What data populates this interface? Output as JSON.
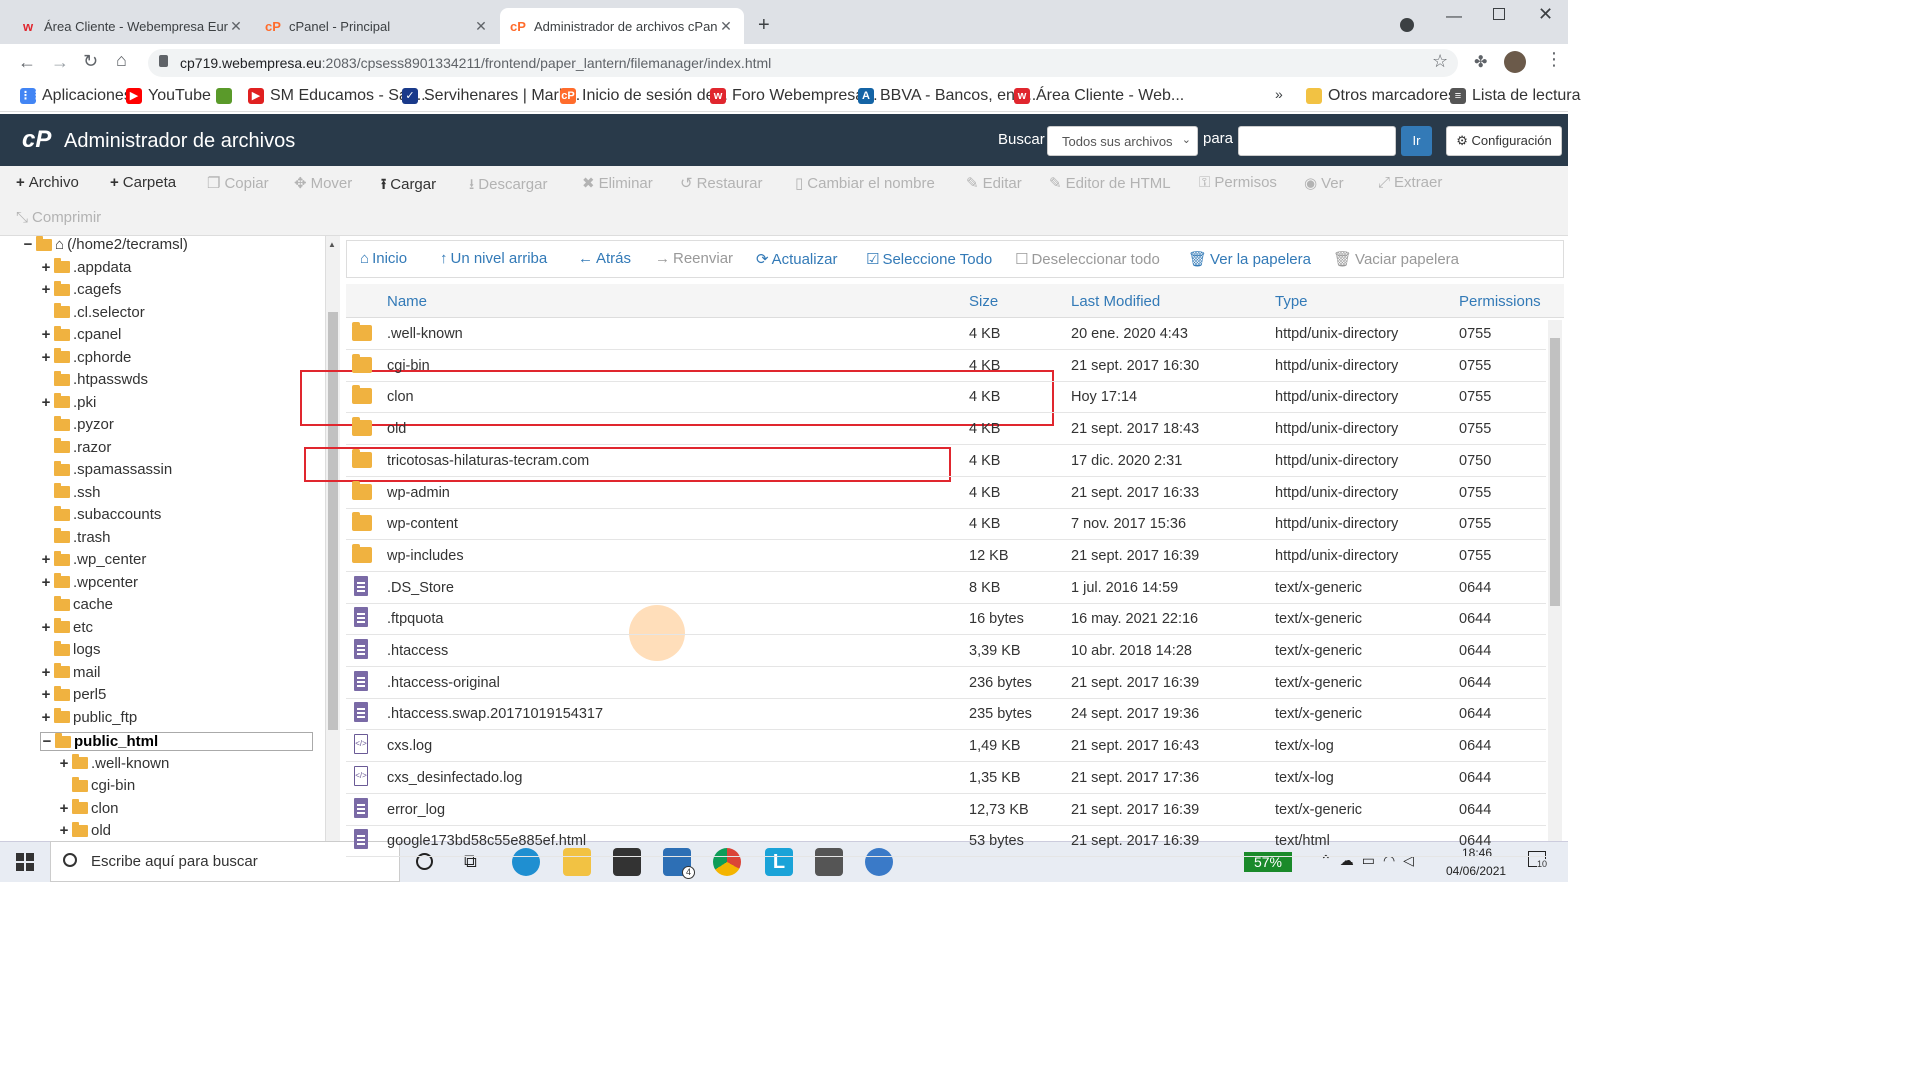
{
  "browser": {
    "tabs": [
      {
        "label": "Área Cliente - Webempresa Euro",
        "active": false
      },
      {
        "label": "cPanel - Principal",
        "active": false
      },
      {
        "label": "Administrador de archivos cPane",
        "active": true
      }
    ],
    "url_host": "cp719.webempresa.eu",
    "url_rest": ":2083/cpsess8901334211/frontend/paper_lantern/filemanager/index.html",
    "bookmarks": [
      "Aplicaciones",
      "YouTube",
      "SM Educamos - San...",
      "Servihenares | Mark...",
      "Inicio de sesión de...",
      "Foro Webempresa...",
      "BBVA - Bancos, enti...",
      "Área Cliente - Web...",
      "Otros marcadores",
      "Lista de lectura"
    ],
    "more_bookmarks": "»"
  },
  "header": {
    "title": "Administrador de archivos",
    "search_label": "Buscar",
    "search_scope": "Todos sus archivos",
    "for_label": "para",
    "go_label": "Ir",
    "settings_label": "Configuración"
  },
  "toolbar": [
    {
      "label": "Archivo",
      "enabled": true,
      "icon": "+"
    },
    {
      "label": "Carpeta",
      "enabled": true,
      "icon": "+"
    },
    {
      "label": "Copiar",
      "enabled": false,
      "icon": "❐"
    },
    {
      "label": "Mover",
      "enabled": false,
      "icon": "✥"
    },
    {
      "label": "Cargar",
      "enabled": true,
      "icon": "⭱"
    },
    {
      "label": "Descargar",
      "enabled": false,
      "icon": "⭳"
    },
    {
      "label": "Eliminar",
      "enabled": false,
      "icon": "✖"
    },
    {
      "label": "Restaurar",
      "enabled": false,
      "icon": "↺"
    },
    {
      "label": "Cambiar el nombre",
      "enabled": false,
      "icon": "▯"
    },
    {
      "label": "Editar",
      "enabled": false,
      "icon": "✎"
    },
    {
      "label": "Editor de HTML",
      "enabled": false,
      "icon": "✎"
    },
    {
      "label": "Permisos",
      "enabled": false,
      "icon": "⚿"
    },
    {
      "label": "Ver",
      "enabled": false,
      "icon": "◉"
    },
    {
      "label": "Extraer",
      "enabled": false,
      "icon": "⤢"
    },
    {
      "label": "Comprimir",
      "enabled": false,
      "icon": "⤡"
    }
  ],
  "tree": {
    "root": "(/home2/tecramsl)",
    "items": [
      {
        "label": ".appdata",
        "toggle": "+"
      },
      {
        "label": ".cagefs",
        "toggle": "+"
      },
      {
        "label": ".cl.selector",
        "toggle": ""
      },
      {
        "label": ".cpanel",
        "toggle": "+"
      },
      {
        "label": ".cphorde",
        "toggle": "+"
      },
      {
        "label": ".htpasswds",
        "toggle": ""
      },
      {
        "label": ".pki",
        "toggle": "+"
      },
      {
        "label": ".pyzor",
        "toggle": ""
      },
      {
        "label": ".razor",
        "toggle": ""
      },
      {
        "label": ".spamassassin",
        "toggle": ""
      },
      {
        "label": ".ssh",
        "toggle": ""
      },
      {
        "label": ".subaccounts",
        "toggle": ""
      },
      {
        "label": ".trash",
        "toggle": ""
      },
      {
        "label": ".wp_center",
        "toggle": "+"
      },
      {
        "label": ".wpcenter",
        "toggle": "+"
      },
      {
        "label": "cache",
        "toggle": ""
      },
      {
        "label": "etc",
        "toggle": "+"
      },
      {
        "label": "logs",
        "toggle": ""
      },
      {
        "label": "mail",
        "toggle": "+"
      },
      {
        "label": "perl5",
        "toggle": "+"
      },
      {
        "label": "public_ftp",
        "toggle": "+"
      },
      {
        "label": "public_html",
        "toggle": "−",
        "selected": true
      }
    ],
    "sub_items": [
      {
        "label": ".well-known",
        "toggle": "+"
      },
      {
        "label": "cgi-bin",
        "toggle": ""
      },
      {
        "label": "clon",
        "toggle": "+"
      },
      {
        "label": "old",
        "toggle": "+"
      }
    ]
  },
  "nav": [
    {
      "label": "Inicio",
      "icon": "⌂",
      "enabled": true
    },
    {
      "label": "Un nivel arriba",
      "icon": "↑",
      "enabled": true
    },
    {
      "label": "Atrás",
      "icon": "←",
      "enabled": true
    },
    {
      "label": "Reenviar",
      "icon": "→",
      "enabled": false
    },
    {
      "label": "Actualizar",
      "icon": "⟳",
      "enabled": true
    },
    {
      "label": "Seleccione Todo",
      "icon": "☑",
      "enabled": true
    },
    {
      "label": "Deseleccionar todo",
      "icon": "☐",
      "enabled": false
    },
    {
      "label": "Ver la papelera",
      "icon": "🗑",
      "enabled": true
    },
    {
      "label": "Vaciar papelera",
      "icon": "🗑",
      "enabled": false
    }
  ],
  "table": {
    "columns": [
      "Name",
      "Size",
      "Last Modified",
      "Type",
      "Permissions"
    ],
    "rows": [
      {
        "name": ".well-known",
        "size": "4 KB",
        "modified": "20 ene. 2020 4:43",
        "type": "httpd/unix-directory",
        "perm": "0755",
        "kind": "dir"
      },
      {
        "name": "cgi-bin",
        "size": "4 KB",
        "modified": "21 sept. 2017 16:30",
        "type": "httpd/unix-directory",
        "perm": "0755",
        "kind": "dir"
      },
      {
        "name": "clon",
        "size": "4 KB",
        "modified": "Hoy 17:14",
        "type": "httpd/unix-directory",
        "perm": "0755",
        "kind": "dir"
      },
      {
        "name": "old",
        "size": "4 KB",
        "modified": "21 sept. 2017 18:43",
        "type": "httpd/unix-directory",
        "perm": "0755",
        "kind": "dir"
      },
      {
        "name": "tricotosas-hilaturas-tecram.com",
        "size": "4 KB",
        "modified": "17 dic. 2020 2:31",
        "type": "httpd/unix-directory",
        "perm": "0750",
        "kind": "dir"
      },
      {
        "name": "wp-admin",
        "size": "4 KB",
        "modified": "21 sept. 2017 16:33",
        "type": "httpd/unix-directory",
        "perm": "0755",
        "kind": "dir"
      },
      {
        "name": "wp-content",
        "size": "4 KB",
        "modified": "7 nov. 2017 15:36",
        "type": "httpd/unix-directory",
        "perm": "0755",
        "kind": "dir"
      },
      {
        "name": "wp-includes",
        "size": "12 KB",
        "modified": "21 sept. 2017 16:39",
        "type": "httpd/unix-directory",
        "perm": "0755",
        "kind": "dir"
      },
      {
        "name": ".DS_Store",
        "size": "8 KB",
        "modified": "1 jul. 2016 14:59",
        "type": "text/x-generic",
        "perm": "0644",
        "kind": "doc"
      },
      {
        "name": ".ftpquota",
        "size": "16 bytes",
        "modified": "16 may. 2021 22:16",
        "type": "text/x-generic",
        "perm": "0644",
        "kind": "doc"
      },
      {
        "name": ".htaccess",
        "size": "3,39 KB",
        "modified": "10 abr. 2018 14:28",
        "type": "text/x-generic",
        "perm": "0644",
        "kind": "doc"
      },
      {
        "name": ".htaccess-original",
        "size": "236 bytes",
        "modified": "21 sept. 2017 16:39",
        "type": "text/x-generic",
        "perm": "0644",
        "kind": "doc"
      },
      {
        "name": ".htaccess.swap.20171019154317",
        "size": "235 bytes",
        "modified": "24 sept. 2017 19:36",
        "type": "text/x-generic",
        "perm": "0644",
        "kind": "doc"
      },
      {
        "name": "cxs.log",
        "size": "1,49 KB",
        "modified": "21 sept. 2017 16:43",
        "type": "text/x-log",
        "perm": "0644",
        "kind": "log"
      },
      {
        "name": "cxs_desinfectado.log",
        "size": "1,35 KB",
        "modified": "21 sept. 2017 17:36",
        "type": "text/x-log",
        "perm": "0644",
        "kind": "log"
      },
      {
        "name": "error_log",
        "size": "12,73 KB",
        "modified": "21 sept. 2017 16:39",
        "type": "text/x-generic",
        "perm": "0644",
        "kind": "doc"
      },
      {
        "name": "google173bd58c55e885ef.html",
        "size": "53 bytes",
        "modified": "21 sept. 2017 16:39",
        "type": "text/html",
        "perm": "0644",
        "kind": "doc"
      }
    ]
  },
  "taskbar": {
    "search_placeholder": "Escribe aquí para buscar",
    "battery": "57%",
    "time": "18:46",
    "date": "04/06/2021",
    "mail_badge": "4",
    "notif_badge": "10"
  }
}
